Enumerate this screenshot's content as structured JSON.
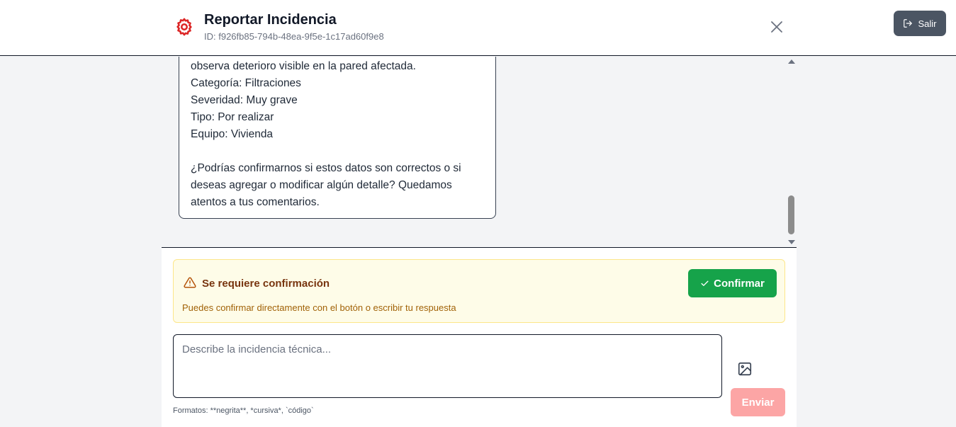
{
  "header": {
    "title": "Reportar Incidencia",
    "id_text": "ID: f926fb85-794b-48ea-9f5e-1c17ad60f9e8",
    "logout_label": "Salir",
    "gear_icon_color": "#dc2626"
  },
  "chat": {
    "message_lines": [
      "observa deterioro visible en la pared afectada.",
      "Categoría: Filtraciones",
      "Severidad: Muy grave",
      "Tipo: Por realizar",
      "Equipo: Vivienda",
      "",
      "¿Podrías confirmarnos si estos datos son correctos o si",
      "deseas agregar o modificar algún detalle? Quedamos",
      "atentos a tus comentarios."
    ]
  },
  "confirmation": {
    "title": "Se requiere confirmación",
    "description": "Puedes confirmar directamente con el botón o escribir tu respuesta",
    "button_label": "Confirmar"
  },
  "composer": {
    "placeholder": "Describe la incidencia técnica...",
    "value": "",
    "send_label": "Enviar",
    "formats_hint": "Formatos: **negrita**, *cursiva*, `código`"
  },
  "colors": {
    "confirm_button": "#16a34a",
    "send_button_disabled": "#fca5a5",
    "warning_bg": "#fefce8",
    "logout_button": "#4b5563"
  }
}
